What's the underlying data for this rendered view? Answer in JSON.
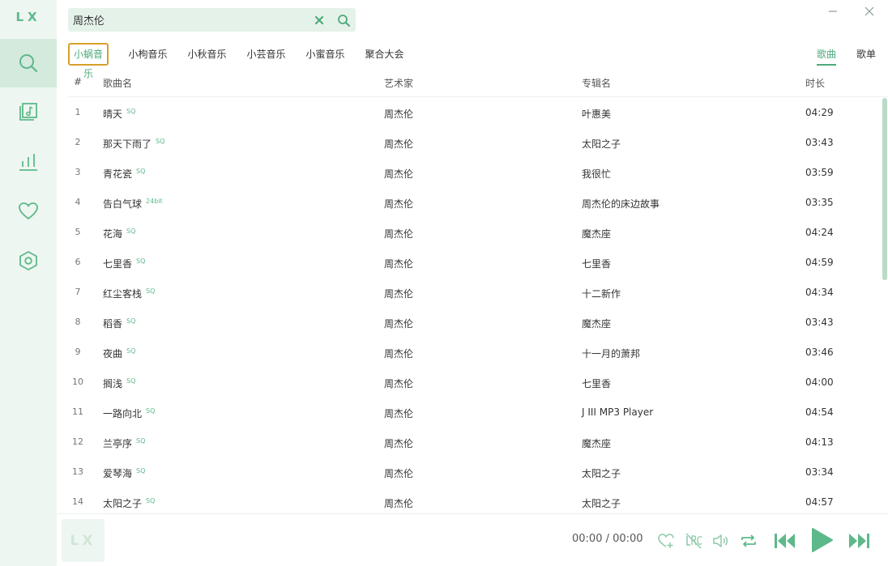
{
  "sidebar": {
    "logo": "LX",
    "items": [
      {
        "icon": "search-icon",
        "active": true
      },
      {
        "icon": "music-library-icon",
        "active": false
      },
      {
        "icon": "leaderboard-icon",
        "active": false
      },
      {
        "icon": "heart-icon",
        "active": false
      },
      {
        "icon": "settings-hexagon-icon",
        "active": false
      }
    ]
  },
  "search": {
    "value": "周杰伦",
    "placeholder": "周杰伦"
  },
  "sources": [
    "小蜗音乐",
    "小枸音乐",
    "小秋音乐",
    "小芸音乐",
    "小蜜音乐",
    "聚合大会"
  ],
  "active_source": "小蜗音乐",
  "result_types": [
    "歌曲",
    "歌单"
  ],
  "active_result_type": "歌曲",
  "table": {
    "headers": {
      "num": "#",
      "name": "歌曲名",
      "artist": "艺术家",
      "album": "专辑名",
      "duration": "时长"
    },
    "rows": [
      {
        "num": "1",
        "name": "晴天",
        "quality": "SQ",
        "artist": "周杰伦",
        "album": "叶惠美",
        "duration": "04:29"
      },
      {
        "num": "2",
        "name": "那天下雨了",
        "quality": "SQ",
        "artist": "周杰伦",
        "album": "太阳之子",
        "duration": "03:43"
      },
      {
        "num": "3",
        "name": "青花瓷",
        "quality": "SQ",
        "artist": "周杰伦",
        "album": "我很忙",
        "duration": "03:59"
      },
      {
        "num": "4",
        "name": "告白气球",
        "quality": "24bit",
        "artist": "周杰伦",
        "album": "周杰伦的床边故事",
        "duration": "03:35"
      },
      {
        "num": "5",
        "name": "花海",
        "quality": "SQ",
        "artist": "周杰伦",
        "album": "魔杰座",
        "duration": "04:24"
      },
      {
        "num": "6",
        "name": "七里香",
        "quality": "SQ",
        "artist": "周杰伦",
        "album": "七里香",
        "duration": "04:59"
      },
      {
        "num": "7",
        "name": "红尘客栈",
        "quality": "SQ",
        "artist": "周杰伦",
        "album": "十二新作",
        "duration": "04:34"
      },
      {
        "num": "8",
        "name": "稻香",
        "quality": "SQ",
        "artist": "周杰伦",
        "album": "魔杰座",
        "duration": "03:43"
      },
      {
        "num": "9",
        "name": "夜曲",
        "quality": "SQ",
        "artist": "周杰伦",
        "album": "十一月的萧邦",
        "duration": "03:46"
      },
      {
        "num": "10",
        "name": "搁浅",
        "quality": "SQ",
        "artist": "周杰伦",
        "album": "七里香",
        "duration": "04:00"
      },
      {
        "num": "11",
        "name": "一路向北",
        "quality": "SQ",
        "artist": "周杰伦",
        "album": "J III MP3 Player",
        "duration": "04:54"
      },
      {
        "num": "12",
        "name": "兰亭序",
        "quality": "SQ",
        "artist": "周杰伦",
        "album": "魔杰座",
        "duration": "04:13"
      },
      {
        "num": "13",
        "name": "爱琴海",
        "quality": "SQ",
        "artist": "周杰伦",
        "album": "太阳之子",
        "duration": "03:34"
      },
      {
        "num": "14",
        "name": "太阳之子",
        "quality": "SQ",
        "artist": "周杰伦",
        "album": "太阳之子",
        "duration": "04:57"
      }
    ]
  },
  "player": {
    "cover_text": "LX",
    "time": "00:00 / 00:00"
  },
  "colors": {
    "accent": "#5db98a",
    "accent_dark": "#4daa7a",
    "sidebar_bg": "#eef6f1",
    "active_source_border": "#d8a02a"
  }
}
